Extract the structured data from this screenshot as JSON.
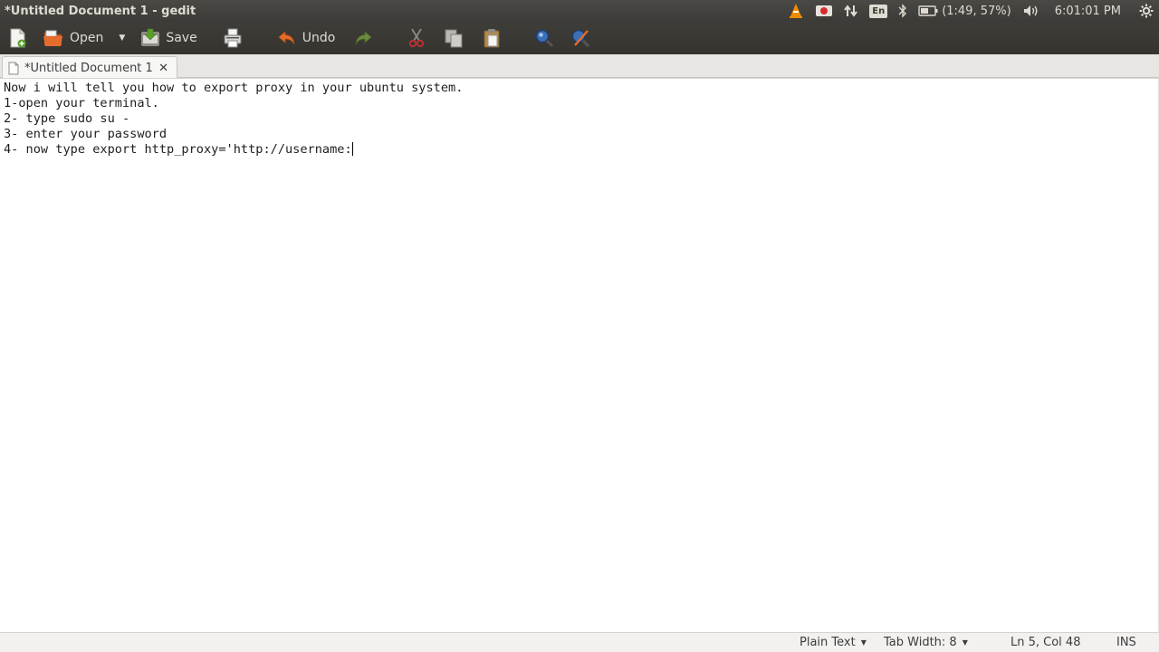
{
  "window": {
    "title": "*Untitled Document 1 - gedit"
  },
  "panel": {
    "indicators": [
      "vlc-icon",
      "record-icon",
      "network-icon",
      "keyboard-icon",
      "bluetooth-icon",
      "battery-icon",
      "volume-icon",
      "settings-gear-icon"
    ],
    "language": "En",
    "battery_text": "(1:49, 57%)",
    "clock": "6:01:01 PM"
  },
  "toolbar": {
    "open_label": "Open",
    "save_label": "Save",
    "undo_label": "Undo"
  },
  "tab": {
    "title": "*Untitled Document 1",
    "close": "✕"
  },
  "editor": {
    "lines": [
      "Now i will tell you how to export proxy in your ubuntu system.",
      "1-open your terminal.",
      "2- type sudo su -",
      "3- enter your password",
      "4- now type export http_proxy='http://username:"
    ]
  },
  "statusbar": {
    "language": "Plain Text",
    "tab_width": "Tab Width: 8",
    "position": "Ln 5, Col 48",
    "mode": "INS"
  },
  "colors": {
    "panel": "#3c3b37",
    "panel_text": "#dfdbd2",
    "vlc_orange": "#f08c00",
    "record_red": "#d92b2b"
  }
}
